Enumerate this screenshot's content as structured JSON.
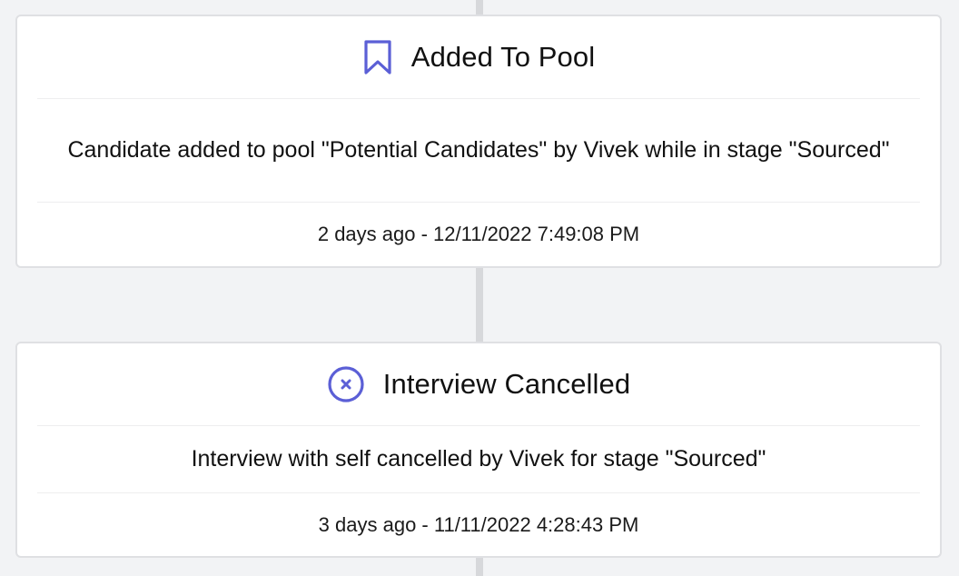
{
  "accent_color": "#5b5fd6",
  "events": [
    {
      "icon": "bookmark-icon",
      "title": "Added To Pool",
      "description": "Candidate added to pool \"Potential Candidates\" by Vivek while in stage \"Sourced\"",
      "timestamp": "2 days ago - 12/11/2022 7:49:08 PM"
    },
    {
      "icon": "cancel-circle-icon",
      "title": "Interview Cancelled",
      "description": "Interview with self cancelled by Vivek for stage \"Sourced\"",
      "timestamp": "3 days ago - 11/11/2022 4:28:43 PM"
    }
  ]
}
